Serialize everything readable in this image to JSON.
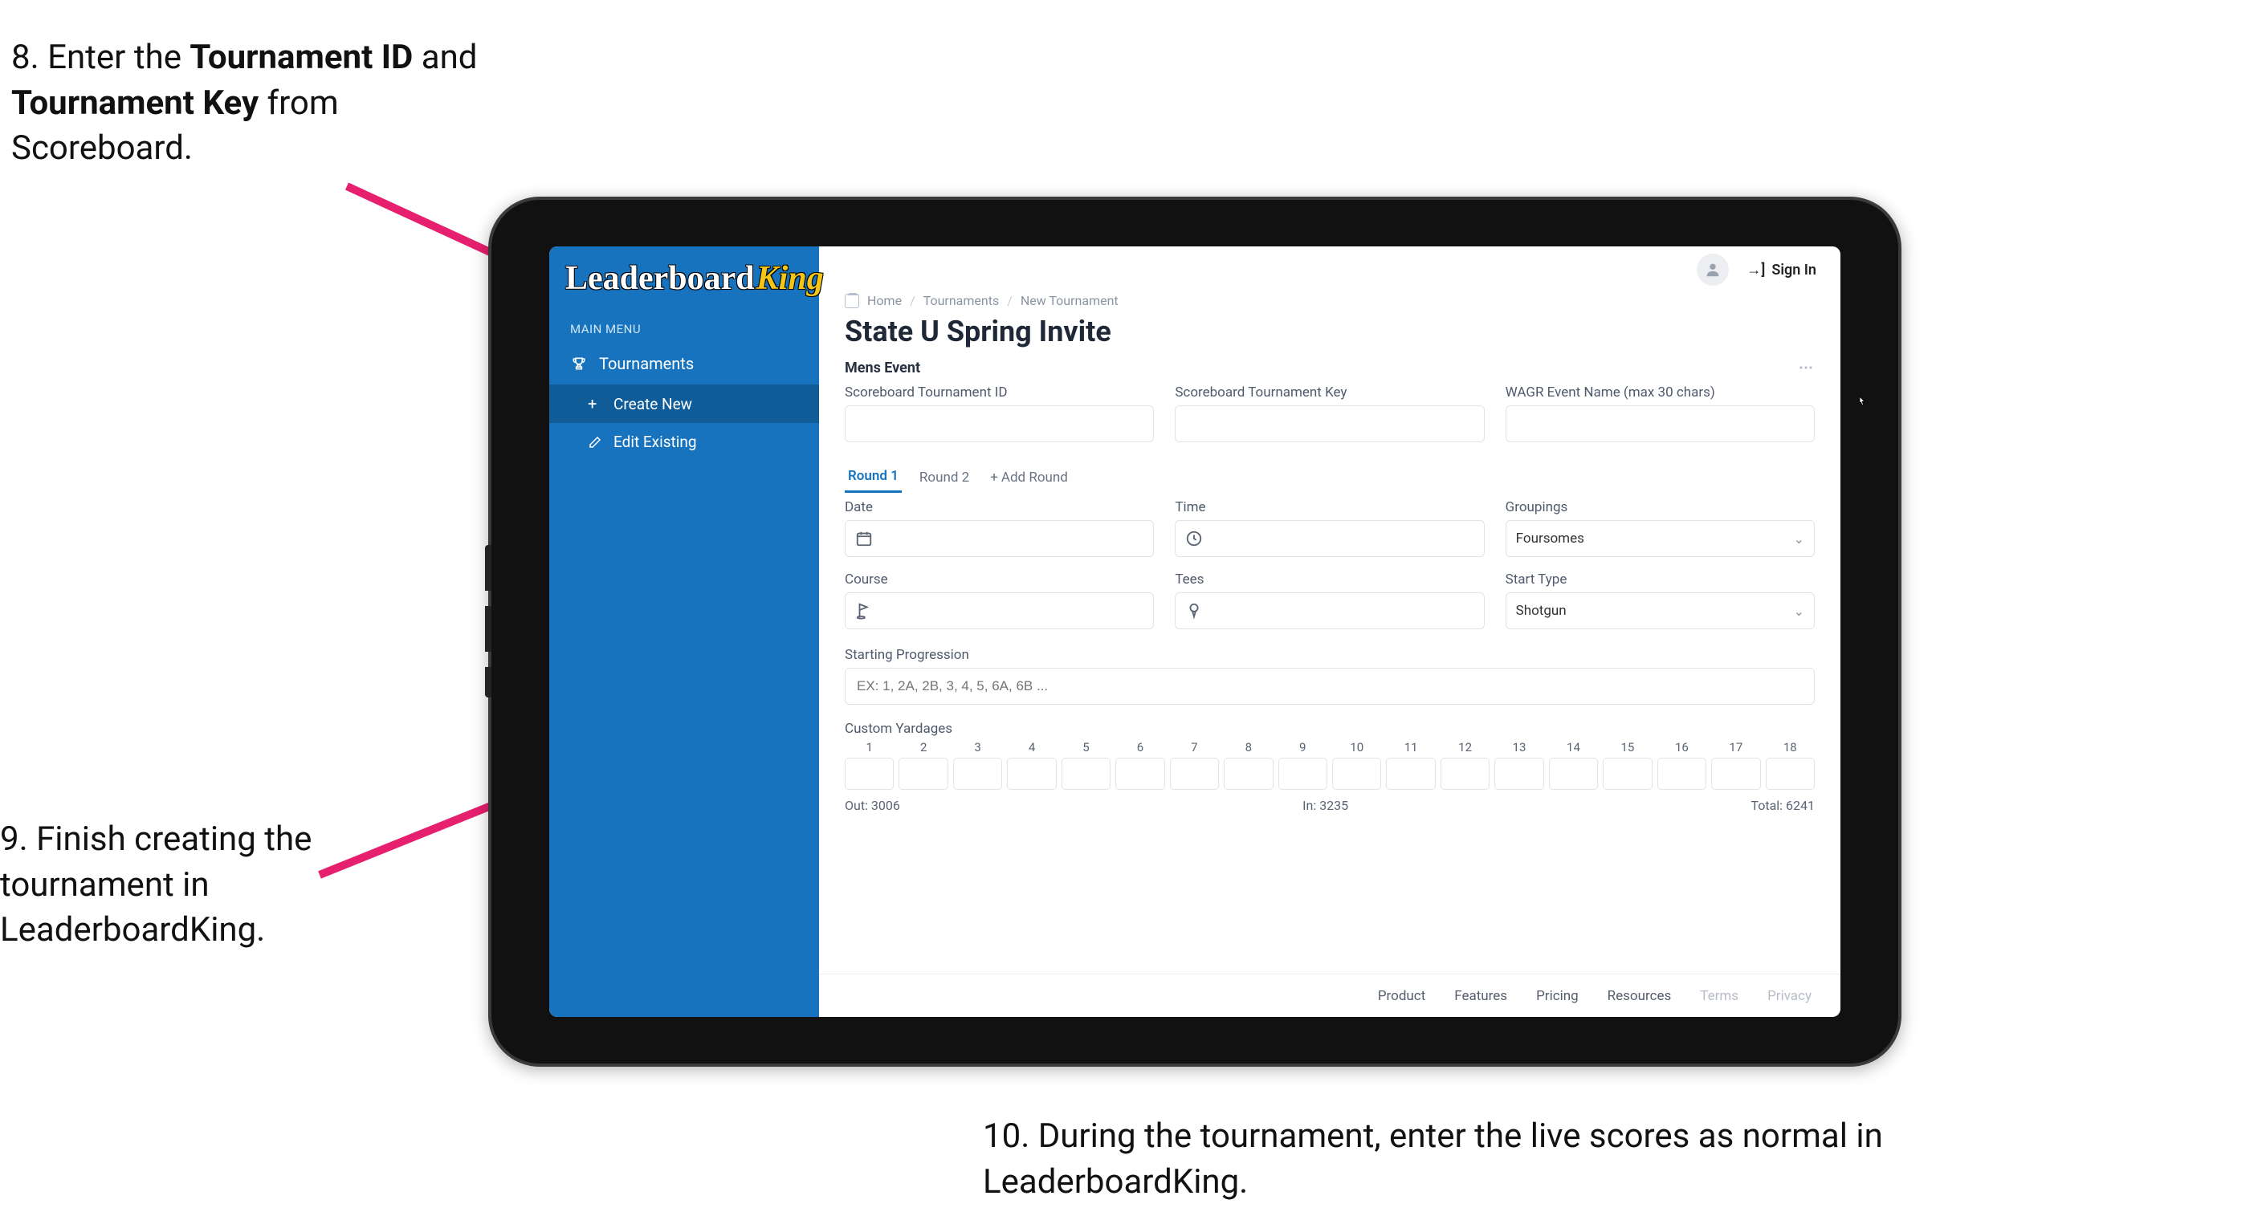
{
  "annotations": {
    "step8_prefix": "8. Enter the ",
    "step8_bold1": "Tournament ID",
    "step8_mid": " and ",
    "step8_bold2": "Tournament Key",
    "step8_suffix": " from Scoreboard.",
    "step9": "9. Finish creating the tournament in LeaderboardKing.",
    "step10": "10. During the tournament, enter the live scores as normal in LeaderboardKing."
  },
  "colors": {
    "sidebar": "#1773be",
    "arrow": "#e61f6e"
  },
  "logo": {
    "line1": "Leaderboard",
    "line2": "King"
  },
  "sidebar": {
    "menu_label": "MAIN MENU",
    "tournaments": "Tournaments",
    "create_new": "Create New",
    "edit_existing": "Edit Existing"
  },
  "topbar": {
    "signin": "Sign In"
  },
  "breadcrumbs": {
    "home": "Home",
    "tournaments": "Tournaments",
    "new": "New Tournament"
  },
  "page": {
    "title": "State U Spring Invite",
    "section": "Mens Event"
  },
  "fields": {
    "tournament_id_label": "Scoreboard Tournament ID",
    "tournament_key_label": "Scoreboard Tournament Key",
    "wagr_label": "WAGR Event Name (max 30 chars)",
    "date_label": "Date",
    "time_label": "Time",
    "groupings_label": "Groupings",
    "groupings_value": "Foursomes",
    "course_label": "Course",
    "tees_label": "Tees",
    "start_type_label": "Start Type",
    "start_type_value": "Shotgun",
    "starting_label": "Starting Progression",
    "starting_placeholder": "EX: 1, 2A, 2B, 3, 4, 5, 6A, 6B ..."
  },
  "tabs": {
    "round1": "Round 1",
    "round2": "Round 2",
    "add_round": "Add Round"
  },
  "yardage": {
    "label": "Custom Yardages",
    "holes": [
      "1",
      "2",
      "3",
      "4",
      "5",
      "6",
      "7",
      "8",
      "9",
      "10",
      "11",
      "12",
      "13",
      "14",
      "15",
      "16",
      "17",
      "18"
    ],
    "out_label": "Out:",
    "out_value": "3006",
    "in_label": "In:",
    "in_value": "3235",
    "total_label": "Total:",
    "total_value": "6241"
  },
  "footer": {
    "product": "Product",
    "features": "Features",
    "pricing": "Pricing",
    "resources": "Resources",
    "terms": "Terms",
    "privacy": "Privacy"
  }
}
